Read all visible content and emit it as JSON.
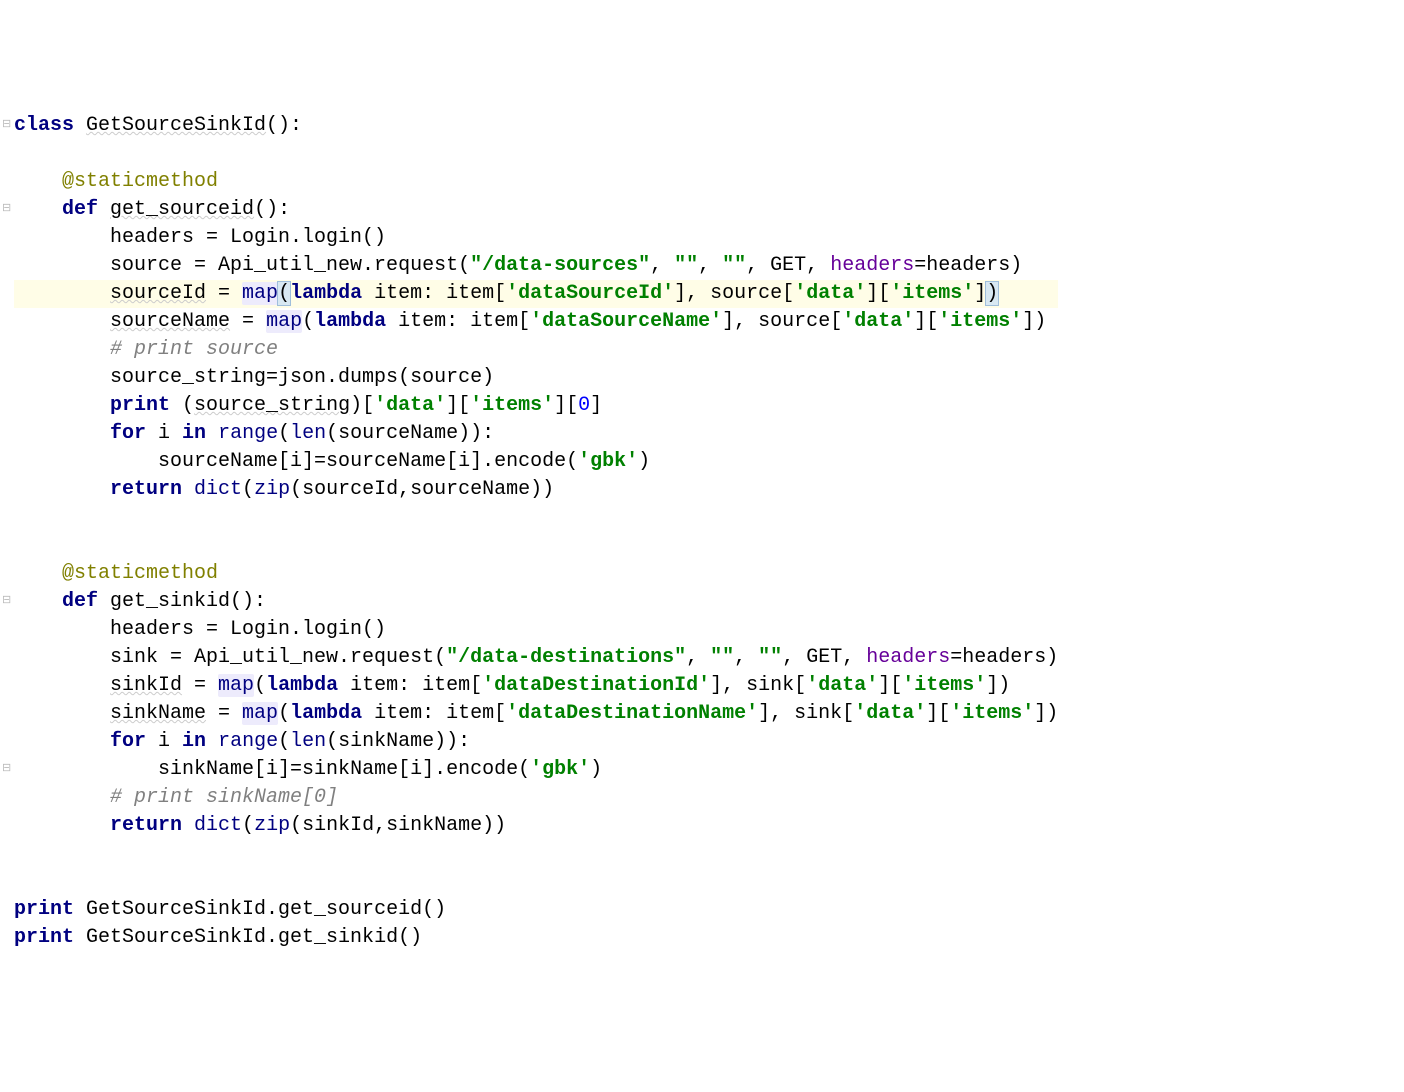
{
  "code": {
    "lines": [
      {
        "type": "code",
        "frags": [
          {
            "cls": "tok-kw",
            "t": "class "
          },
          {
            "cls": "tok-id wavy",
            "t": "GetSourceSinkId"
          },
          {
            "cls": "tok-id",
            "t": "():"
          }
        ]
      },
      {
        "type": "blank"
      },
      {
        "type": "code",
        "indent": 4,
        "frags": [
          {
            "cls": "tok-dec",
            "t": "@staticmethod"
          }
        ]
      },
      {
        "type": "code",
        "indent": 4,
        "frags": [
          {
            "cls": "tok-kw",
            "t": "def "
          },
          {
            "cls": "tok-id wavy",
            "t": "get_sourceid"
          },
          {
            "cls": "tok-id",
            "t": "():"
          }
        ]
      },
      {
        "type": "code",
        "indent": 8,
        "frags": [
          {
            "cls": "tok-id",
            "t": "headers = Login.login()"
          }
        ]
      },
      {
        "type": "code",
        "indent": 8,
        "frags": [
          {
            "cls": "tok-id",
            "t": "source = Api_util_new.request("
          },
          {
            "cls": "tok-str",
            "t": "\"/data-sources\""
          },
          {
            "cls": "tok-id",
            "t": ", "
          },
          {
            "cls": "tok-str",
            "t": "\"\""
          },
          {
            "cls": "tok-id",
            "t": ", "
          },
          {
            "cls": "tok-str",
            "t": "\"\""
          },
          {
            "cls": "tok-id",
            "t": ", GET, "
          },
          {
            "cls": "tok-kwarg",
            "t": "headers"
          },
          {
            "cls": "tok-id",
            "t": "=headers)"
          }
        ]
      },
      {
        "type": "code",
        "indent": 8,
        "hl": true,
        "frags": [
          {
            "cls": "tok-id wavy",
            "t": "sourceId"
          },
          {
            "cls": "tok-id",
            "t": " = "
          },
          {
            "cls": "tok-builtin sel-match",
            "t": "map"
          },
          {
            "cls": "tok-id paren-match",
            "t": "("
          },
          {
            "cls": "tok-kw",
            "t": "lambda "
          },
          {
            "cls": "tok-id",
            "t": "item: item["
          },
          {
            "cls": "tok-str",
            "t": "'dataSourceId'"
          },
          {
            "cls": "tok-id",
            "t": "], source["
          },
          {
            "cls": "tok-str",
            "t": "'data'"
          },
          {
            "cls": "tok-id",
            "t": "]["
          },
          {
            "cls": "tok-str",
            "t": "'items'"
          },
          {
            "cls": "tok-id",
            "t": "]"
          },
          {
            "cls": "tok-id paren-match",
            "t": ")"
          }
        ]
      },
      {
        "type": "code",
        "indent": 8,
        "frags": [
          {
            "cls": "tok-id wavy",
            "t": "sourceName"
          },
          {
            "cls": "tok-id",
            "t": " = "
          },
          {
            "cls": "tok-builtin sel-match",
            "t": "map"
          },
          {
            "cls": "tok-id",
            "t": "("
          },
          {
            "cls": "tok-kw",
            "t": "lambda "
          },
          {
            "cls": "tok-id",
            "t": "item: item["
          },
          {
            "cls": "tok-str",
            "t": "'dataSourceName'"
          },
          {
            "cls": "tok-id",
            "t": "], source["
          },
          {
            "cls": "tok-str",
            "t": "'data'"
          },
          {
            "cls": "tok-id",
            "t": "]["
          },
          {
            "cls": "tok-str",
            "t": "'items'"
          },
          {
            "cls": "tok-id",
            "t": "])"
          }
        ]
      },
      {
        "type": "code",
        "indent": 8,
        "frags": [
          {
            "cls": "tok-comment",
            "t": "# print source"
          }
        ]
      },
      {
        "type": "code",
        "indent": 8,
        "frags": [
          {
            "cls": "tok-id",
            "t": "source_string=json.dumps(source)"
          }
        ]
      },
      {
        "type": "code",
        "indent": 8,
        "frags": [
          {
            "cls": "tok-kw",
            "t": "print "
          },
          {
            "cls": "tok-id",
            "t": "("
          },
          {
            "cls": "tok-id wavy",
            "t": "source_string"
          },
          {
            "cls": "tok-id",
            "t": ")["
          },
          {
            "cls": "tok-str",
            "t": "'data'"
          },
          {
            "cls": "tok-id",
            "t": "]["
          },
          {
            "cls": "tok-str",
            "t": "'items'"
          },
          {
            "cls": "tok-id",
            "t": "]["
          },
          {
            "cls": "tok-num",
            "t": "0"
          },
          {
            "cls": "tok-id",
            "t": "]"
          }
        ]
      },
      {
        "type": "code",
        "indent": 8,
        "frags": [
          {
            "cls": "tok-kw",
            "t": "for "
          },
          {
            "cls": "tok-id",
            "t": "i "
          },
          {
            "cls": "tok-kw",
            "t": "in "
          },
          {
            "cls": "tok-builtin",
            "t": "range"
          },
          {
            "cls": "tok-id",
            "t": "("
          },
          {
            "cls": "tok-builtin",
            "t": "len"
          },
          {
            "cls": "tok-id",
            "t": "(sourceName)):"
          }
        ]
      },
      {
        "type": "code",
        "indent": 12,
        "frags": [
          {
            "cls": "tok-id",
            "t": "sourceName[i]=sourceName[i].encode("
          },
          {
            "cls": "tok-str",
            "t": "'gbk'"
          },
          {
            "cls": "tok-id",
            "t": ")"
          }
        ]
      },
      {
        "type": "code",
        "indent": 8,
        "frags": [
          {
            "cls": "tok-kw",
            "t": "return "
          },
          {
            "cls": "tok-builtin",
            "t": "dict"
          },
          {
            "cls": "tok-id",
            "t": "("
          },
          {
            "cls": "tok-builtin",
            "t": "zip"
          },
          {
            "cls": "tok-id",
            "t": "(sourceId,sourceName))"
          }
        ]
      },
      {
        "type": "blank"
      },
      {
        "type": "blank"
      },
      {
        "type": "code",
        "indent": 4,
        "frags": [
          {
            "cls": "tok-dec",
            "t": "@staticmethod"
          }
        ]
      },
      {
        "type": "code",
        "indent": 4,
        "frags": [
          {
            "cls": "tok-kw",
            "t": "def "
          },
          {
            "cls": "tok-id",
            "t": "get_sinkid():"
          }
        ]
      },
      {
        "type": "code",
        "indent": 8,
        "frags": [
          {
            "cls": "tok-id",
            "t": "headers = Login.login()"
          }
        ]
      },
      {
        "type": "code",
        "indent": 8,
        "frags": [
          {
            "cls": "tok-id",
            "t": "sink = Api_util_new.request("
          },
          {
            "cls": "tok-str",
            "t": "\"/data-destinations\""
          },
          {
            "cls": "tok-id",
            "t": ", "
          },
          {
            "cls": "tok-str",
            "t": "\"\""
          },
          {
            "cls": "tok-id",
            "t": ", "
          },
          {
            "cls": "tok-str",
            "t": "\"\""
          },
          {
            "cls": "tok-id",
            "t": ", GET, "
          },
          {
            "cls": "tok-kwarg",
            "t": "headers"
          },
          {
            "cls": "tok-id",
            "t": "=headers)"
          }
        ]
      },
      {
        "type": "code",
        "indent": 8,
        "frags": [
          {
            "cls": "tok-id wavy",
            "t": "sinkId"
          },
          {
            "cls": "tok-id",
            "t": " = "
          },
          {
            "cls": "tok-builtin sel-match",
            "t": "map"
          },
          {
            "cls": "tok-id",
            "t": "("
          },
          {
            "cls": "tok-kw",
            "t": "lambda "
          },
          {
            "cls": "tok-id",
            "t": "item: item["
          },
          {
            "cls": "tok-str",
            "t": "'dataDestinationId'"
          },
          {
            "cls": "tok-id",
            "t": "], sink["
          },
          {
            "cls": "tok-str",
            "t": "'data'"
          },
          {
            "cls": "tok-id",
            "t": "]["
          },
          {
            "cls": "tok-str",
            "t": "'items'"
          },
          {
            "cls": "tok-id",
            "t": "])"
          }
        ]
      },
      {
        "type": "code",
        "indent": 8,
        "frags": [
          {
            "cls": "tok-id wavy",
            "t": "sinkName"
          },
          {
            "cls": "tok-id",
            "t": " = "
          },
          {
            "cls": "tok-builtin sel-match",
            "t": "map"
          },
          {
            "cls": "tok-id",
            "t": "("
          },
          {
            "cls": "tok-kw",
            "t": "lambda "
          },
          {
            "cls": "tok-id",
            "t": "item: item["
          },
          {
            "cls": "tok-str",
            "t": "'dataDestinationName'"
          },
          {
            "cls": "tok-id",
            "t": "], sink["
          },
          {
            "cls": "tok-str",
            "t": "'data'"
          },
          {
            "cls": "tok-id",
            "t": "]["
          },
          {
            "cls": "tok-str",
            "t": "'items'"
          },
          {
            "cls": "tok-id",
            "t": "])"
          }
        ]
      },
      {
        "type": "code",
        "indent": 8,
        "frags": [
          {
            "cls": "tok-kw",
            "t": "for "
          },
          {
            "cls": "tok-id",
            "t": "i "
          },
          {
            "cls": "tok-kw",
            "t": "in "
          },
          {
            "cls": "tok-builtin",
            "t": "range"
          },
          {
            "cls": "tok-id",
            "t": "("
          },
          {
            "cls": "tok-builtin",
            "t": "len"
          },
          {
            "cls": "tok-id",
            "t": "(sinkName)):"
          }
        ]
      },
      {
        "type": "code",
        "indent": 12,
        "frags": [
          {
            "cls": "tok-id",
            "t": "sinkName[i]=sinkName[i].encode("
          },
          {
            "cls": "tok-str",
            "t": "'gbk'"
          },
          {
            "cls": "tok-id",
            "t": ")"
          }
        ]
      },
      {
        "type": "code",
        "indent": 8,
        "frags": [
          {
            "cls": "tok-comment",
            "t": "# print sinkName[0]"
          }
        ]
      },
      {
        "type": "code",
        "indent": 8,
        "frags": [
          {
            "cls": "tok-kw",
            "t": "return "
          },
          {
            "cls": "tok-builtin",
            "t": "dict"
          },
          {
            "cls": "tok-id",
            "t": "("
          },
          {
            "cls": "tok-builtin",
            "t": "zip"
          },
          {
            "cls": "tok-id",
            "t": "(sinkId,sinkName))"
          }
        ]
      },
      {
        "type": "blank"
      },
      {
        "type": "blank"
      },
      {
        "type": "code",
        "indent": 0,
        "frags": [
          {
            "cls": "tok-kw",
            "t": "print "
          },
          {
            "cls": "tok-id",
            "t": "GetSourceSinkId.get_sourceid()"
          }
        ]
      },
      {
        "type": "code",
        "indent": 0,
        "frags": [
          {
            "cls": "tok-kw",
            "t": "print "
          },
          {
            "cls": "tok-id",
            "t": "GetSourceSinkId.get_sinkid()"
          }
        ]
      }
    ]
  },
  "gutter": {
    "folds": [
      0,
      3,
      17,
      23
    ],
    "bulb_line": 6
  }
}
